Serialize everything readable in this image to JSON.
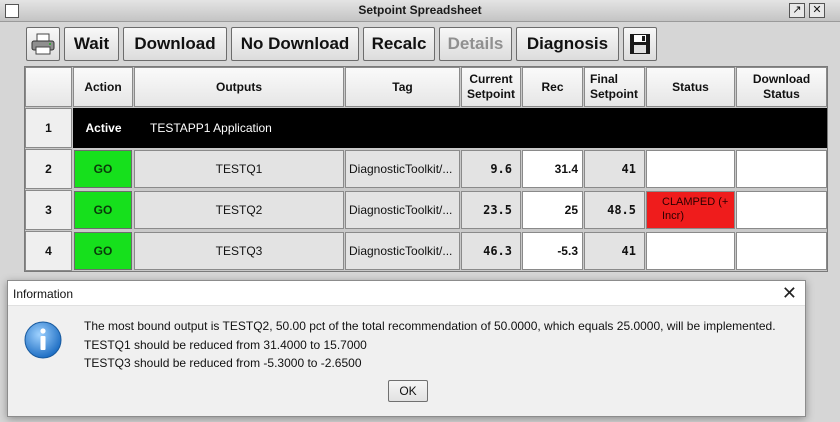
{
  "window": {
    "title": "Setpoint Spreadsheet",
    "restore_glyph": "↗",
    "close_glyph": "✕"
  },
  "toolbar": {
    "print_icon": "printer-icon",
    "wait_label": "Wait",
    "download_label": "Download",
    "no_download_label": "No Download",
    "recalc_label": "Recalc",
    "details_label": "Details",
    "diagnosis_label": "Diagnosis",
    "save_icon": "floppy-disk-icon"
  },
  "table": {
    "columns": [
      "",
      "Action",
      "Outputs",
      "Tag",
      "Current\nSetpoint",
      "Rec",
      "Final\nSetpoint",
      "Status",
      "Download\nStatus"
    ],
    "header_row": {
      "num": "1",
      "action": "Active",
      "application": "TESTAPP1 Application"
    },
    "rows": [
      {
        "num": "2",
        "action": "GO",
        "output": "TESTQ1",
        "tag": "DiagnosticToolkit/...",
        "current": "9.6",
        "rec": "31.4",
        "final": "41",
        "status": "",
        "download_status": ""
      },
      {
        "num": "3",
        "action": "GO",
        "output": "TESTQ2",
        "tag": "DiagnosticToolkit/...",
        "current": "23.5",
        "rec": "25",
        "final": "48.5",
        "status": "CLAMPED (+ Incr)",
        "download_status": ""
      },
      {
        "num": "4",
        "action": "GO",
        "output": "TESTQ3",
        "tag": "DiagnosticToolkit/...",
        "current": "46.3",
        "rec": "-5.3",
        "final": "41",
        "status": "",
        "download_status": ""
      }
    ]
  },
  "dialog": {
    "title": "Information",
    "close_glyph": "✕",
    "icon": "info-icon",
    "lines": [
      "The most bound output is TESTQ2, 50.00 pct of the total recommendation of 50.0000, which equals 25.0000, will be implemented.",
      "TESTQ1 should be reduced from 31.4000 to 15.7000",
      "TESTQ3 should be reduced from -5.3000 to -2.6500"
    ],
    "ok_label": "OK"
  },
  "colors": {
    "go_green": "#16e01c",
    "clamped_red": "#ef1c1c",
    "active_black": "#000000",
    "info_blue": "#2a7fd4"
  }
}
